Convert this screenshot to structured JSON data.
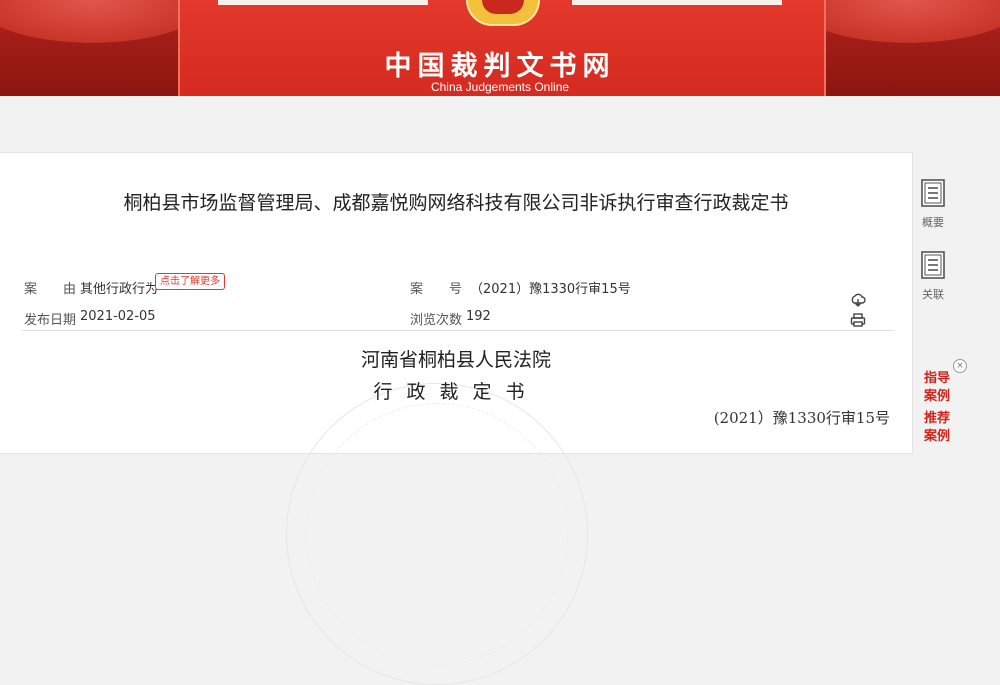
{
  "header": {
    "site_title": "中国裁判文书网",
    "site_subtitle": "China Judgements Online"
  },
  "document": {
    "title": "桐柏县市场监督管理局、成都嘉悦购网络科技有限公司非诉执行审查行政裁定书",
    "meta": {
      "cause_label": "案　　由",
      "cause_value": "其他行政行为",
      "more_tag": "点击了解更多",
      "case_no_label": "案　　号",
      "case_no_value": "（2021）豫1330行审15号",
      "publish_date_label": "发布日期",
      "publish_date_value": "2021-02-05",
      "views_label": "浏览次数",
      "views_value": "192"
    },
    "body": {
      "court": "河南省桐柏县人民法院",
      "doc_type": "行政裁定书",
      "case_number": "(2021）豫1330行审15号"
    }
  },
  "sidebar": {
    "summary_label": "概要",
    "related_label": "关联",
    "guide_line1": "指导",
    "guide_line2": "案例",
    "recommend_line1": "推荐",
    "recommend_line2": "案例",
    "close_symbol": "×"
  },
  "colors": {
    "brand_red": "#d42a1f",
    "accent_red": "#e53b2f"
  }
}
